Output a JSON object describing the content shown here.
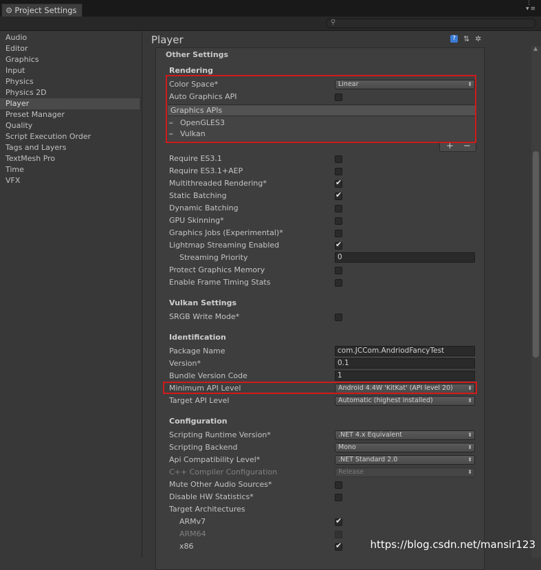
{
  "window": {
    "tab_title": "Project Settings",
    "search_placeholder": ""
  },
  "sidebar": {
    "items": [
      {
        "label": "Audio"
      },
      {
        "label": "Editor"
      },
      {
        "label": "Graphics"
      },
      {
        "label": "Input"
      },
      {
        "label": "Physics"
      },
      {
        "label": "Physics 2D"
      },
      {
        "label": "Player",
        "selected": true
      },
      {
        "label": "Preset Manager"
      },
      {
        "label": "Quality"
      },
      {
        "label": "Script Execution Order"
      },
      {
        "label": "Tags and Layers"
      },
      {
        "label": "TextMesh Pro"
      },
      {
        "label": "Time"
      },
      {
        "label": "VFX"
      }
    ]
  },
  "header": {
    "title": "Player",
    "icons": [
      "help-icon",
      "presets-icon",
      "gear-icon"
    ]
  },
  "other_settings": {
    "title": "Other Settings",
    "rendering": {
      "title": "Rendering",
      "color_space_label": "Color Space*",
      "color_space_value": "Linear",
      "auto_graphics_api_label": "Auto Graphics API",
      "auto_graphics_api": false,
      "graphics_apis_header": "Graphics APIs",
      "graphics_apis": [
        "OpenGLES3",
        "Vulkan"
      ],
      "add_symbol": "+",
      "remove_symbol": "−",
      "require_es31_label": "Require ES3.1",
      "require_es31": false,
      "require_es31_aep_label": "Require ES3.1+AEP",
      "require_es31_aep": false,
      "multithreaded_label": "Multithreaded Rendering*",
      "multithreaded": true,
      "static_batching_label": "Static Batching",
      "static_batching": true,
      "dynamic_batching_label": "Dynamic Batching",
      "dynamic_batching": false,
      "gpu_skinning_label": "GPU Skinning*",
      "gpu_skinning": false,
      "graphics_jobs_label": "Graphics Jobs (Experimental)*",
      "graphics_jobs": false,
      "lightmap_streaming_label": "Lightmap Streaming Enabled",
      "lightmap_streaming": true,
      "streaming_priority_label": "Streaming Priority",
      "streaming_priority_value": "0",
      "protect_memory_label": "Protect Graphics Memory",
      "protect_memory": false,
      "frame_timing_label": "Enable Frame Timing Stats",
      "frame_timing": false
    },
    "vulkan": {
      "title": "Vulkan Settings",
      "srgb_write_label": "SRGB Write Mode*",
      "srgb_write": false
    },
    "identification": {
      "title": "Identification",
      "package_name_label": "Package Name",
      "package_name_value": "com.JCCom.AndriodFancyTest",
      "version_label": "Version*",
      "version_value": "0.1",
      "bundle_code_label": "Bundle Version Code",
      "bundle_code_value": "1",
      "min_api_label": "Minimum API Level",
      "min_api_value": "Android 4.4W 'KitKat' (API level 20)",
      "target_api_label": "Target API Level",
      "target_api_value": "Automatic (highest installed)"
    },
    "configuration": {
      "title": "Configuration",
      "runtime_label": "Scripting Runtime Version*",
      "runtime_value": ".NET 4.x Equivalent",
      "backend_label": "Scripting Backend",
      "backend_value": "Mono",
      "api_compat_label": "Api Compatibility Level*",
      "api_compat_value": ".NET Standard 2.0",
      "cpp_config_label": "C++ Compiler Configuration",
      "cpp_config_value": "Release",
      "mute_audio_label": "Mute Other Audio Sources*",
      "mute_audio": false,
      "disable_hw_stats_label": "Disable HW Statistics*",
      "disable_hw_stats": false,
      "target_arch_label": "Target Architectures",
      "armv7_label": "ARMv7",
      "armv7": true,
      "arm64_label": "ARM64",
      "arm64": false,
      "x86_label": "x86",
      "x86": true
    }
  },
  "watermark": "https://blog.csdn.net/mansir123"
}
